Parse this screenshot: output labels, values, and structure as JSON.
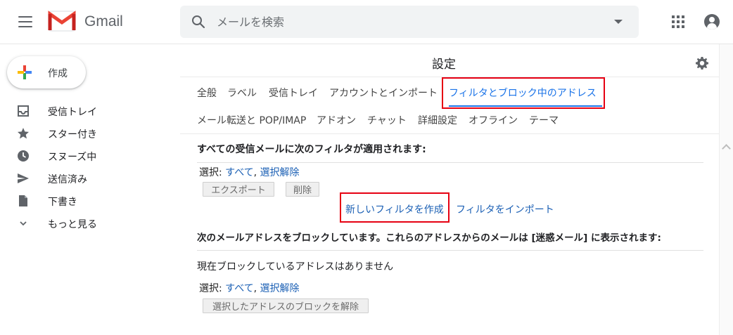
{
  "app": {
    "name": "Gmail"
  },
  "search": {
    "placeholder": "メールを検索"
  },
  "compose": {
    "label": "作成"
  },
  "sidebar": {
    "items": [
      {
        "label": "受信トレイ",
        "icon": "inbox-icon"
      },
      {
        "label": "スター付き",
        "icon": "star-icon"
      },
      {
        "label": "スヌーズ中",
        "icon": "clock-icon"
      },
      {
        "label": "送信済み",
        "icon": "send-icon"
      },
      {
        "label": "下書き",
        "icon": "draft-icon"
      },
      {
        "label": "もっと見る",
        "icon": "chevron-down-icon"
      }
    ]
  },
  "settings": {
    "title": "設定",
    "tabs_row1": [
      "全般",
      "ラベル",
      "受信トレイ",
      "アカウントとインポート",
      "フィルタとブロック中のアドレス"
    ],
    "tabs_row2": [
      "メール転送と POP/IMAP",
      "アドオン",
      "チャット",
      "詳細設定",
      "オフライン",
      "テーマ"
    ],
    "active_tab": "フィルタとブロック中のアドレス",
    "filters": {
      "heading": "すべての受信メールに次のフィルタが適用されます:",
      "select_label": "選択:",
      "select_all": "すべて",
      "select_none": "選択解除",
      "export_button": "エクスポート",
      "delete_button": "削除",
      "create_filter": "新しいフィルタを作成",
      "import_filter": "フィルタをインポート"
    },
    "blocked": {
      "heading": "次のメールアドレスをブロックしています。これらのアドレスからのメールは [迷惑メール] に表示されます:",
      "empty_message": "現在ブロックしているアドレスはありません",
      "select_label": "選択:",
      "select_all": "すべて",
      "select_none": "選択解除",
      "unblock_button": "選択したアドレスのブロックを解除"
    }
  },
  "colors": {
    "accent": "#1a73e8",
    "link": "#1a5fb4",
    "highlight": "#e60012",
    "gmail_red": "#ea4335"
  }
}
